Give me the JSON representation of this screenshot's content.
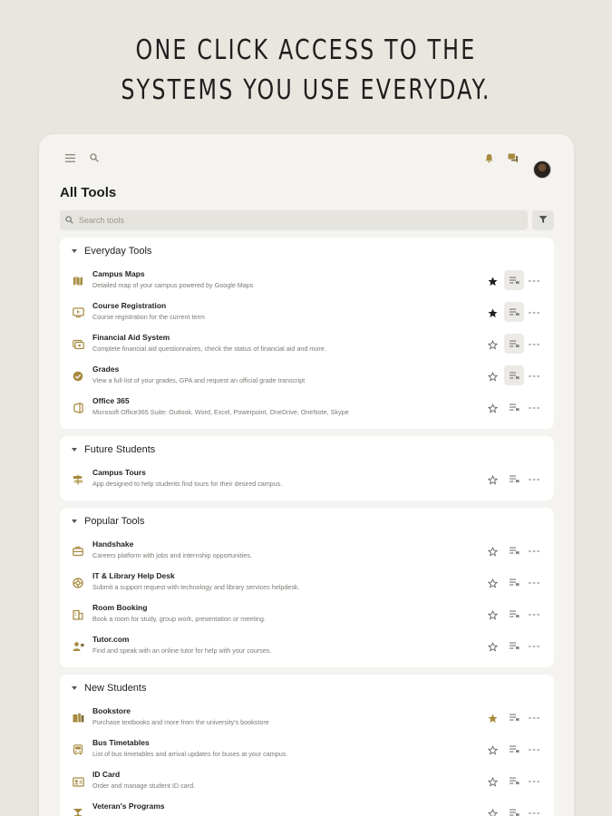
{
  "headline": {
    "line1": "ONE CLICK ACCESS TO THE",
    "line2": "SYSTEMS YOU USE EVERYDAY."
  },
  "toolbar": {
    "menu_icon": "hamburger-icon",
    "search_icon": "search-icon",
    "notifications_icon": "bell-icon",
    "messages_icon": "chat-icon"
  },
  "page": {
    "title": "All Tools",
    "search_placeholder": "Search tools"
  },
  "colors": {
    "accent": "#a68a3f",
    "star_filled": "#1f1f1f",
    "background": "#e9e6df",
    "card": "#ffffff"
  },
  "sections": [
    {
      "title": "Everyday Tools",
      "items": [
        {
          "name": "Campus Maps",
          "desc": "Detailed map of your campus powered by Google Maps",
          "icon": "map-icon",
          "starred": true,
          "star_color": "dark",
          "pinned": true
        },
        {
          "name": "Course Registration",
          "desc": "Course registration for the current term",
          "icon": "registration-icon",
          "starred": true,
          "star_color": "dark",
          "pinned": true
        },
        {
          "name": "Financial Aid System",
          "desc": "Complete financial aid questionnaires, check the status of financial aid and more.",
          "icon": "money-icon",
          "starred": false,
          "pinned": true
        },
        {
          "name": "Grades",
          "desc": "View a full-list of your grades, GPA and request an official grade transcript",
          "icon": "badge-check-icon",
          "starred": false,
          "pinned": true
        },
        {
          "name": "Office 365",
          "desc": "Microsoft Office365 Suite: Outlook, Word, Excel, Powerpoint, OneDrive, OneNote, Skype",
          "icon": "office-icon",
          "starred": false,
          "pinned": false
        }
      ]
    },
    {
      "title": "Future Students",
      "items": [
        {
          "name": "Campus Tours",
          "desc": "App designed to help students find tours for their desired campus.",
          "icon": "signpost-icon",
          "starred": false,
          "pinned": false
        }
      ]
    },
    {
      "title": "Popular Tools",
      "items": [
        {
          "name": "Handshake",
          "desc": "Careers platform with jobs and internship opportunities.",
          "icon": "briefcase-icon",
          "starred": false,
          "pinned": false
        },
        {
          "name": "IT & Library Help Desk",
          "desc": "Submit a support request with technology and library services helpdesk.",
          "icon": "lifebuoy-icon",
          "starred": false,
          "pinned": false
        },
        {
          "name": "Room Booking",
          "desc": "Book a room for study, group work, presentation or meeting.",
          "icon": "building-icon",
          "starred": false,
          "pinned": false
        },
        {
          "name": "Tutor.com",
          "desc": "Find and speak with an online tutor for help with your courses.",
          "icon": "tutor-icon",
          "starred": false,
          "pinned": false
        }
      ]
    },
    {
      "title": "New Students",
      "items": [
        {
          "name": "Bookstore",
          "desc": "Purchase textbooks and more from the university's bookstore",
          "icon": "book-icon",
          "starred": true,
          "star_color": "gold",
          "pinned": false
        },
        {
          "name": "Bus Timetables",
          "desc": "List of bus timetables and arrival updates for buses at your campus.",
          "icon": "bus-icon",
          "starred": false,
          "pinned": false
        },
        {
          "name": "ID Card",
          "desc": "Order and manage student ID card.",
          "icon": "id-card-icon",
          "starred": false,
          "pinned": false
        },
        {
          "name": "Veteran's Programs",
          "desc": "",
          "icon": "veteran-icon",
          "starred": false,
          "pinned": false
        }
      ]
    }
  ]
}
